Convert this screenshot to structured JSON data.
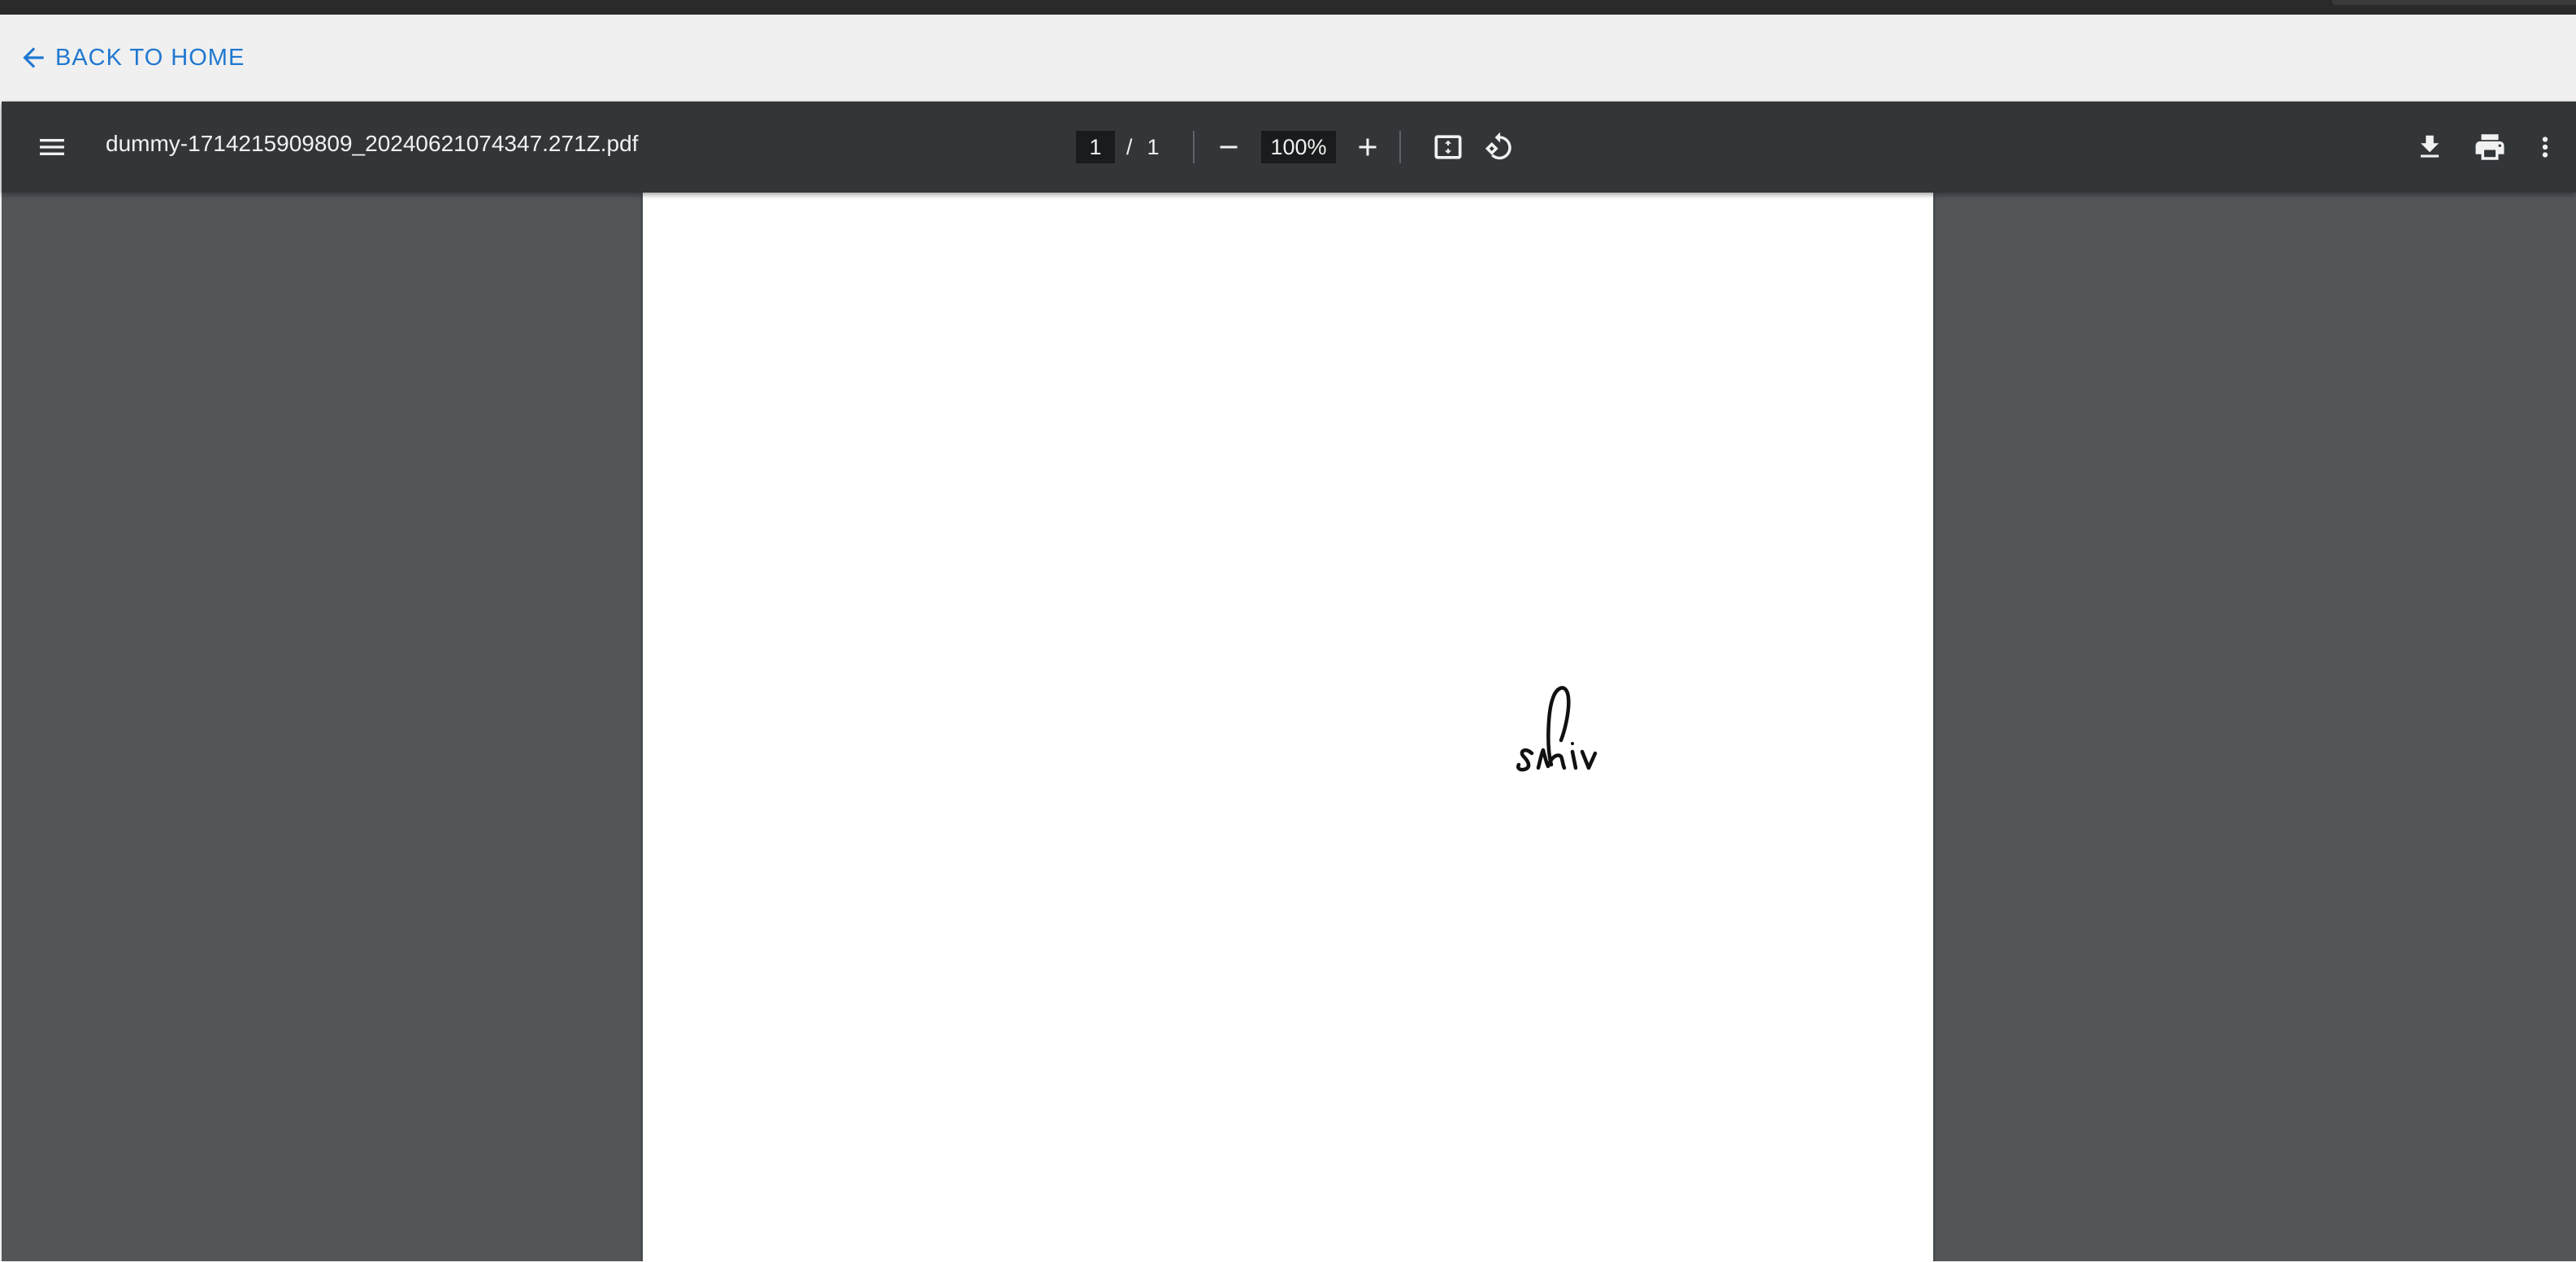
{
  "app": {
    "back_link_label": "BACK TO HOME"
  },
  "viewer": {
    "file_title": "dummy-1714215909809_20240621074347.271Z.pdf",
    "current_page": "1",
    "page_separator": "/",
    "total_pages": "1",
    "zoom_level": "100%"
  },
  "document": {
    "signature_text": "Shiv"
  },
  "icons": {
    "back": "arrow-left-icon",
    "menu": "menu-icon",
    "zoom_out": "minus-icon",
    "zoom_in": "plus-icon",
    "fit": "fit-to-page-icon",
    "rotate": "rotate-icon",
    "download": "download-icon",
    "print": "print-icon",
    "more": "more-vert-icon"
  },
  "colors": {
    "link": "#1f78d1",
    "toolbar": "#323639",
    "viewer_background": "#525659",
    "page": "#ffffff"
  }
}
